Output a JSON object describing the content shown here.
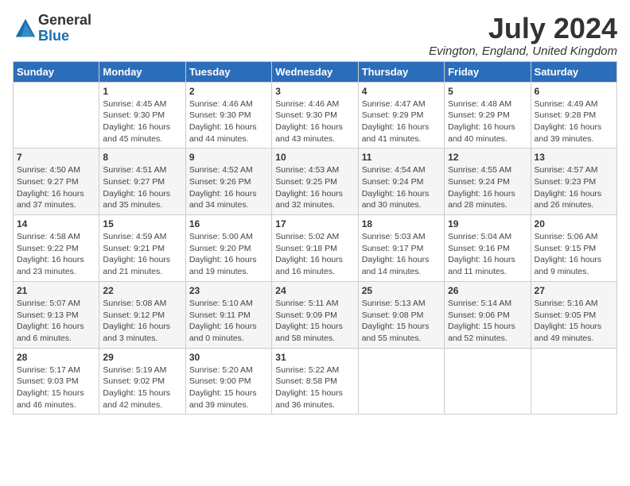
{
  "logo": {
    "general": "General",
    "blue": "Blue"
  },
  "title": "July 2024",
  "location": "Evington, England, United Kingdom",
  "days_header": [
    "Sunday",
    "Monday",
    "Tuesday",
    "Wednesday",
    "Thursday",
    "Friday",
    "Saturday"
  ],
  "weeks": [
    [
      {
        "day": "",
        "sunrise": "",
        "sunset": "",
        "daylight": ""
      },
      {
        "day": "1",
        "sunrise": "Sunrise: 4:45 AM",
        "sunset": "Sunset: 9:30 PM",
        "daylight": "Daylight: 16 hours and 45 minutes."
      },
      {
        "day": "2",
        "sunrise": "Sunrise: 4:46 AM",
        "sunset": "Sunset: 9:30 PM",
        "daylight": "Daylight: 16 hours and 44 minutes."
      },
      {
        "day": "3",
        "sunrise": "Sunrise: 4:46 AM",
        "sunset": "Sunset: 9:30 PM",
        "daylight": "Daylight: 16 hours and 43 minutes."
      },
      {
        "day": "4",
        "sunrise": "Sunrise: 4:47 AM",
        "sunset": "Sunset: 9:29 PM",
        "daylight": "Daylight: 16 hours and 41 minutes."
      },
      {
        "day": "5",
        "sunrise": "Sunrise: 4:48 AM",
        "sunset": "Sunset: 9:29 PM",
        "daylight": "Daylight: 16 hours and 40 minutes."
      },
      {
        "day": "6",
        "sunrise": "Sunrise: 4:49 AM",
        "sunset": "Sunset: 9:28 PM",
        "daylight": "Daylight: 16 hours and 39 minutes."
      }
    ],
    [
      {
        "day": "7",
        "sunrise": "Sunrise: 4:50 AM",
        "sunset": "Sunset: 9:27 PM",
        "daylight": "Daylight: 16 hours and 37 minutes."
      },
      {
        "day": "8",
        "sunrise": "Sunrise: 4:51 AM",
        "sunset": "Sunset: 9:27 PM",
        "daylight": "Daylight: 16 hours and 35 minutes."
      },
      {
        "day": "9",
        "sunrise": "Sunrise: 4:52 AM",
        "sunset": "Sunset: 9:26 PM",
        "daylight": "Daylight: 16 hours and 34 minutes."
      },
      {
        "day": "10",
        "sunrise": "Sunrise: 4:53 AM",
        "sunset": "Sunset: 9:25 PM",
        "daylight": "Daylight: 16 hours and 32 minutes."
      },
      {
        "day": "11",
        "sunrise": "Sunrise: 4:54 AM",
        "sunset": "Sunset: 9:24 PM",
        "daylight": "Daylight: 16 hours and 30 minutes."
      },
      {
        "day": "12",
        "sunrise": "Sunrise: 4:55 AM",
        "sunset": "Sunset: 9:24 PM",
        "daylight": "Daylight: 16 hours and 28 minutes."
      },
      {
        "day": "13",
        "sunrise": "Sunrise: 4:57 AM",
        "sunset": "Sunset: 9:23 PM",
        "daylight": "Daylight: 16 hours and 26 minutes."
      }
    ],
    [
      {
        "day": "14",
        "sunrise": "Sunrise: 4:58 AM",
        "sunset": "Sunset: 9:22 PM",
        "daylight": "Daylight: 16 hours and 23 minutes."
      },
      {
        "day": "15",
        "sunrise": "Sunrise: 4:59 AM",
        "sunset": "Sunset: 9:21 PM",
        "daylight": "Daylight: 16 hours and 21 minutes."
      },
      {
        "day": "16",
        "sunrise": "Sunrise: 5:00 AM",
        "sunset": "Sunset: 9:20 PM",
        "daylight": "Daylight: 16 hours and 19 minutes."
      },
      {
        "day": "17",
        "sunrise": "Sunrise: 5:02 AM",
        "sunset": "Sunset: 9:18 PM",
        "daylight": "Daylight: 16 hours and 16 minutes."
      },
      {
        "day": "18",
        "sunrise": "Sunrise: 5:03 AM",
        "sunset": "Sunset: 9:17 PM",
        "daylight": "Daylight: 16 hours and 14 minutes."
      },
      {
        "day": "19",
        "sunrise": "Sunrise: 5:04 AM",
        "sunset": "Sunset: 9:16 PM",
        "daylight": "Daylight: 16 hours and 11 minutes."
      },
      {
        "day": "20",
        "sunrise": "Sunrise: 5:06 AM",
        "sunset": "Sunset: 9:15 PM",
        "daylight": "Daylight: 16 hours and 9 minutes."
      }
    ],
    [
      {
        "day": "21",
        "sunrise": "Sunrise: 5:07 AM",
        "sunset": "Sunset: 9:13 PM",
        "daylight": "Daylight: 16 hours and 6 minutes."
      },
      {
        "day": "22",
        "sunrise": "Sunrise: 5:08 AM",
        "sunset": "Sunset: 9:12 PM",
        "daylight": "Daylight: 16 hours and 3 minutes."
      },
      {
        "day": "23",
        "sunrise": "Sunrise: 5:10 AM",
        "sunset": "Sunset: 9:11 PM",
        "daylight": "Daylight: 16 hours and 0 minutes."
      },
      {
        "day": "24",
        "sunrise": "Sunrise: 5:11 AM",
        "sunset": "Sunset: 9:09 PM",
        "daylight": "Daylight: 15 hours and 58 minutes."
      },
      {
        "day": "25",
        "sunrise": "Sunrise: 5:13 AM",
        "sunset": "Sunset: 9:08 PM",
        "daylight": "Daylight: 15 hours and 55 minutes."
      },
      {
        "day": "26",
        "sunrise": "Sunrise: 5:14 AM",
        "sunset": "Sunset: 9:06 PM",
        "daylight": "Daylight: 15 hours and 52 minutes."
      },
      {
        "day": "27",
        "sunrise": "Sunrise: 5:16 AM",
        "sunset": "Sunset: 9:05 PM",
        "daylight": "Daylight: 15 hours and 49 minutes."
      }
    ],
    [
      {
        "day": "28",
        "sunrise": "Sunrise: 5:17 AM",
        "sunset": "Sunset: 9:03 PM",
        "daylight": "Daylight: 15 hours and 46 minutes."
      },
      {
        "day": "29",
        "sunrise": "Sunrise: 5:19 AM",
        "sunset": "Sunset: 9:02 PM",
        "daylight": "Daylight: 15 hours and 42 minutes."
      },
      {
        "day": "30",
        "sunrise": "Sunrise: 5:20 AM",
        "sunset": "Sunset: 9:00 PM",
        "daylight": "Daylight: 15 hours and 39 minutes."
      },
      {
        "day": "31",
        "sunrise": "Sunrise: 5:22 AM",
        "sunset": "Sunset: 8:58 PM",
        "daylight": "Daylight: 15 hours and 36 minutes."
      },
      {
        "day": "",
        "sunrise": "",
        "sunset": "",
        "daylight": ""
      },
      {
        "day": "",
        "sunrise": "",
        "sunset": "",
        "daylight": ""
      },
      {
        "day": "",
        "sunrise": "",
        "sunset": "",
        "daylight": ""
      }
    ]
  ]
}
